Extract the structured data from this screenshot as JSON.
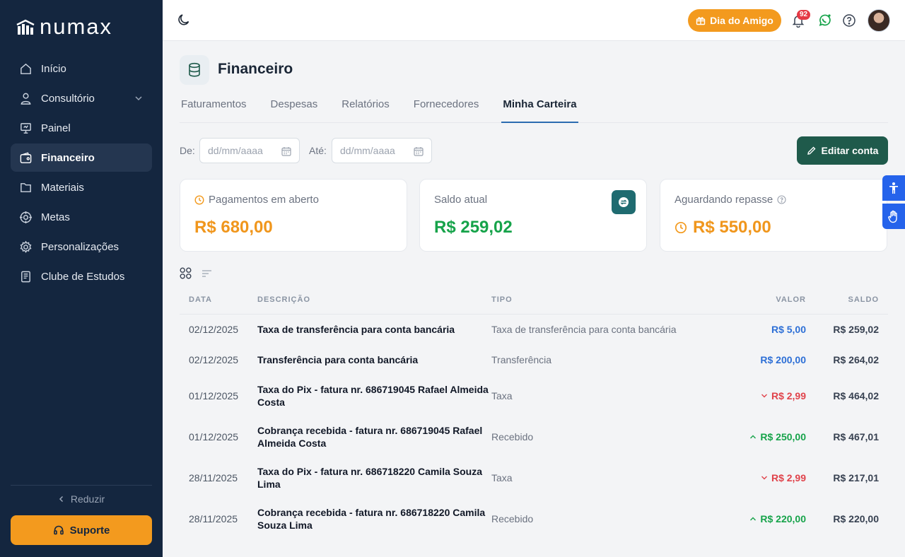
{
  "app": {
    "logo_text": "numax"
  },
  "sidebar": {
    "items": [
      {
        "label": "Início",
        "icon": "home-icon"
      },
      {
        "label": "Consultório",
        "icon": "user-icon"
      },
      {
        "label": "Painel",
        "icon": "presentation-icon"
      },
      {
        "label": "Financeiro",
        "icon": "wallet-icon",
        "active": true
      },
      {
        "label": "Materiais",
        "icon": "folder-icon"
      },
      {
        "label": "Metas",
        "icon": "target-icon"
      },
      {
        "label": "Personalizações",
        "icon": "gear-icon"
      },
      {
        "label": "Clube de Estudos",
        "icon": "book-icon"
      }
    ],
    "collapse_label": "Reduzir",
    "support_label": "Suporte"
  },
  "topbar": {
    "promo_label": "Dia do Amigo",
    "notification_count": "92"
  },
  "page": {
    "title": "Financeiro",
    "tabs": [
      "Faturamentos",
      "Despesas",
      "Relatórios",
      "Fornecedores",
      "Minha Carteira"
    ],
    "active_tab": "Minha Carteira"
  },
  "filters": {
    "from_label": "De:",
    "to_label": "Até:",
    "from_placeholder": "dd/mm/aaaa",
    "to_placeholder": "dd/mm/aaaa",
    "edit_account_label": "Editar conta"
  },
  "cards": {
    "open": {
      "label": "Pagamentos em aberto",
      "value": "R$ 680,00"
    },
    "balance": {
      "label": "Saldo atual",
      "value": "R$ 259,02"
    },
    "pending": {
      "label": "Aguardando repasse",
      "value": "R$ 550,00"
    }
  },
  "colors": {
    "sidebar_bg": "#14263f",
    "accent_orange": "#f39a1e",
    "primary_green": "#1f5a4b",
    "balance_green": "#16a34a",
    "link_blue": "#2d6fd6",
    "negative_red": "#e0434b"
  },
  "table": {
    "headers": {
      "date": "DATA",
      "desc": "DESCRIÇÃO",
      "type": "TIPO",
      "value": "VALOR",
      "balance": "SALDO"
    },
    "rows": [
      {
        "date": "02/12/2025",
        "desc": "Taxa de transferência para conta bancária",
        "type": "Taxa de transferência para conta bancária",
        "value": "R$ 5,00",
        "balance": "R$ 259,02",
        "kind": "blue"
      },
      {
        "date": "02/12/2025",
        "desc": "Transferência para conta bancária",
        "type": "Transferência",
        "value": "R$ 200,00",
        "balance": "R$ 264,02",
        "kind": "blue"
      },
      {
        "date": "01/12/2025",
        "desc": "Taxa do Pix - fatura nr. 686719045 Rafael Almeida Costa",
        "type": "Taxa",
        "value": "R$ 2,99",
        "balance": "R$ 464,02",
        "kind": "down"
      },
      {
        "date": "01/12/2025",
        "desc": "Cobrança recebida - fatura nr. 686719045 Rafael Almeida Costa",
        "type": "Recebido",
        "value": "R$ 250,00",
        "balance": "R$ 467,01",
        "kind": "up"
      },
      {
        "date": "28/11/2025",
        "desc": "Taxa do Pix - fatura nr. 686718220 Camila Souza Lima",
        "type": "Taxa",
        "value": "R$ 2,99",
        "balance": "R$ 217,01",
        "kind": "down"
      },
      {
        "date": "28/11/2025",
        "desc": "Cobrança recebida - fatura nr. 686718220 Camila Souza Lima",
        "type": "Recebido",
        "value": "R$ 220,00",
        "balance": "R$ 220,00",
        "kind": "up"
      }
    ]
  }
}
